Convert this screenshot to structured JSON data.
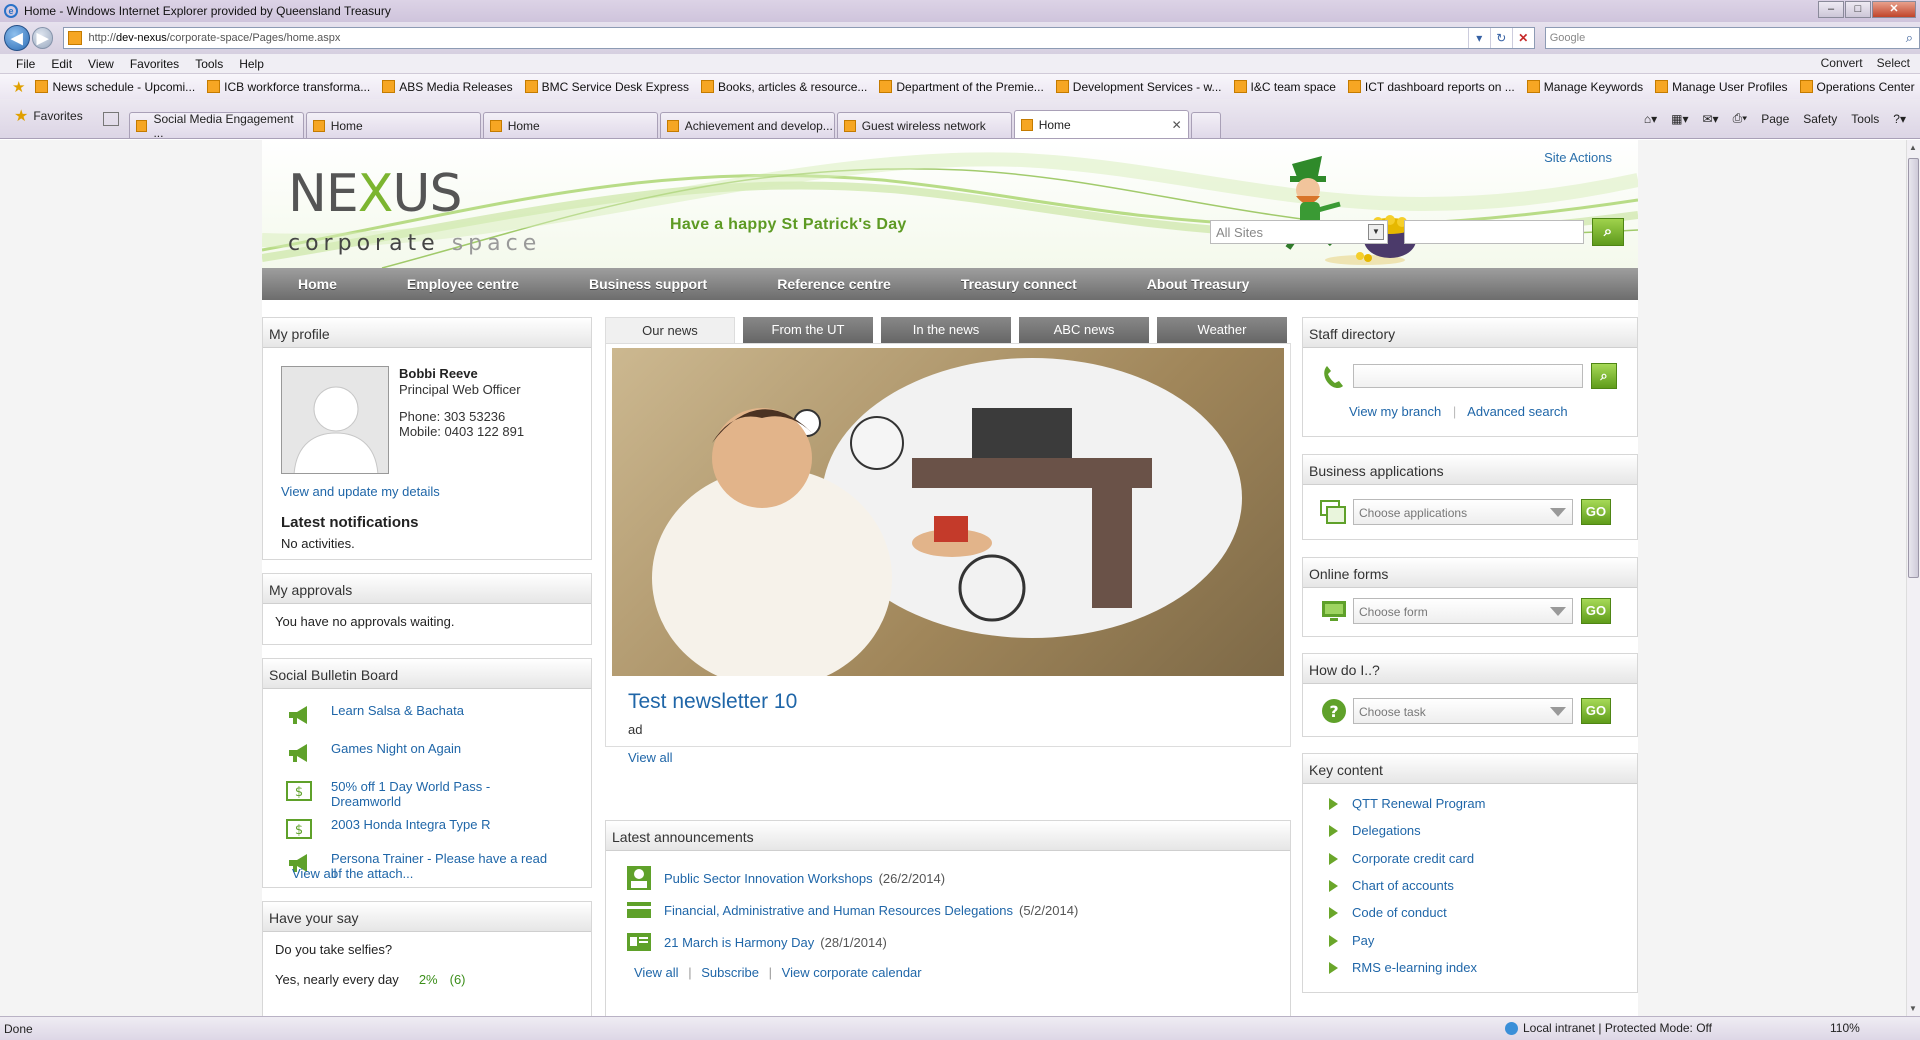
{
  "browser": {
    "title": "Home - Windows Internet Explorer provided by Queensland Treasury",
    "url_prefix": "http://",
    "url_host": "dev-nexus",
    "url_path": "/corporate-space/Pages/home.aspx",
    "search_placeholder": "Google",
    "menu": [
      "File",
      "Edit",
      "View",
      "Favorites",
      "Tools",
      "Help"
    ],
    "menu_right": [
      "Convert",
      "Select"
    ],
    "favorites_bar": [
      "News schedule - Upcomi...",
      "ICB workforce transforma...",
      "ABS Media Releases",
      "BMC Service Desk Express",
      "Books, articles & resource...",
      "Department of the Premie...",
      "Development Services - w...",
      "I&C team space",
      "ICT dashboard reports on ...",
      "Manage Keywords",
      "Manage User Profiles",
      "Operations Center"
    ],
    "favorites_label": "Favorites",
    "tabs": [
      "Social Media Engagement ...",
      "Home",
      "Home",
      "Achievement and develop...",
      "Guest wireless network",
      "Home"
    ],
    "command_bar": [
      "Page",
      "Safety",
      "Tools"
    ],
    "status_left": "Done",
    "status_zone": "Local intranet | Protected Mode: Off",
    "zoom": "110%"
  },
  "site": {
    "logo_main_a": "NE",
    "logo_main_b": "X",
    "logo_main_c": "US",
    "logo_sub_a": "corporate ",
    "logo_sub_b": "space",
    "greeting": "Have a happy St Patrick's Day",
    "site_actions": "Site Actions",
    "scope": "All Sites",
    "nav": [
      "Home",
      "Employee centre",
      "Business support",
      "Reference centre",
      "Treasury connect",
      "About Treasury"
    ]
  },
  "profile": {
    "heading": "My profile",
    "name": "Bobbi Reeve",
    "role": "Principal Web Officer",
    "phone": "Phone: 303 53236",
    "mobile": "Mobile: 0403 122 891",
    "update_link": "View and update my details",
    "notifications_title": "Latest notifications",
    "notifications_text": "No activities."
  },
  "approvals": {
    "heading": "My approvals",
    "text": "You have no approvals waiting."
  },
  "bulletin": {
    "heading": "Social Bulletin Board",
    "items": [
      {
        "label": "Learn Salsa & Bachata",
        "icon": "megaphone-icon"
      },
      {
        "label": "Games Night on Again",
        "icon": "megaphone-icon"
      },
      {
        "label": "50% off 1 Day World Pass - Dreamworld",
        "icon": "money-icon"
      },
      {
        "label": "2003 Honda Integra Type R",
        "icon": "money-icon"
      },
      {
        "label": "Persona Trainer - Please have a read of the attach...",
        "icon": "megaphone-icon"
      }
    ],
    "view_all": "View all"
  },
  "poll": {
    "heading": "Have your say",
    "question": "Do you take selfies?",
    "option_partial": "Yes, nearly every day",
    "percent": "2%",
    "count": "(6)"
  },
  "news": {
    "tabs": [
      "Our news",
      "From the UT",
      "In the news",
      "ABC news",
      "Weather"
    ],
    "headline": "Test newsletter 10",
    "summary": "ad",
    "view_all": "View all"
  },
  "announcements": {
    "heading": "Latest announcements",
    "items": [
      {
        "title": "Public Sector Innovation Workshops",
        "date": "(26/2/2014)",
        "icon": "person-card-icon"
      },
      {
        "title": "Financial, Administrative and Human Resources Delegations",
        "date": "(5/2/2014)",
        "icon": "credit-card-icon"
      },
      {
        "title": "21 March is Harmony Day",
        "date": "(28/1/2014)",
        "icon": "id-card-icon"
      }
    ],
    "footer": [
      "View all",
      "Subscribe",
      "View corporate calendar"
    ]
  },
  "staff_directory": {
    "heading": "Staff directory",
    "links": [
      "View my branch",
      "Advanced search"
    ]
  },
  "business_apps": {
    "heading": "Business applications",
    "placeholder": "Choose applications",
    "go": "GO"
  },
  "online_forms": {
    "heading": "Online forms",
    "placeholder": "Choose form",
    "go": "GO"
  },
  "how_do_i": {
    "heading": "How do I..?",
    "placeholder": "Choose task",
    "go": "GO"
  },
  "key_content": {
    "heading": "Key content",
    "items": [
      "QTT Renewal Program",
      "Delegations",
      "Corporate credit card",
      "Chart of accounts",
      "Code of conduct",
      "Pay",
      "RMS e-learning index"
    ]
  },
  "colors": {
    "accent_green": "#6aa62a",
    "link_blue": "#1f66a8",
    "nav_gray": "#7d7d7d"
  }
}
